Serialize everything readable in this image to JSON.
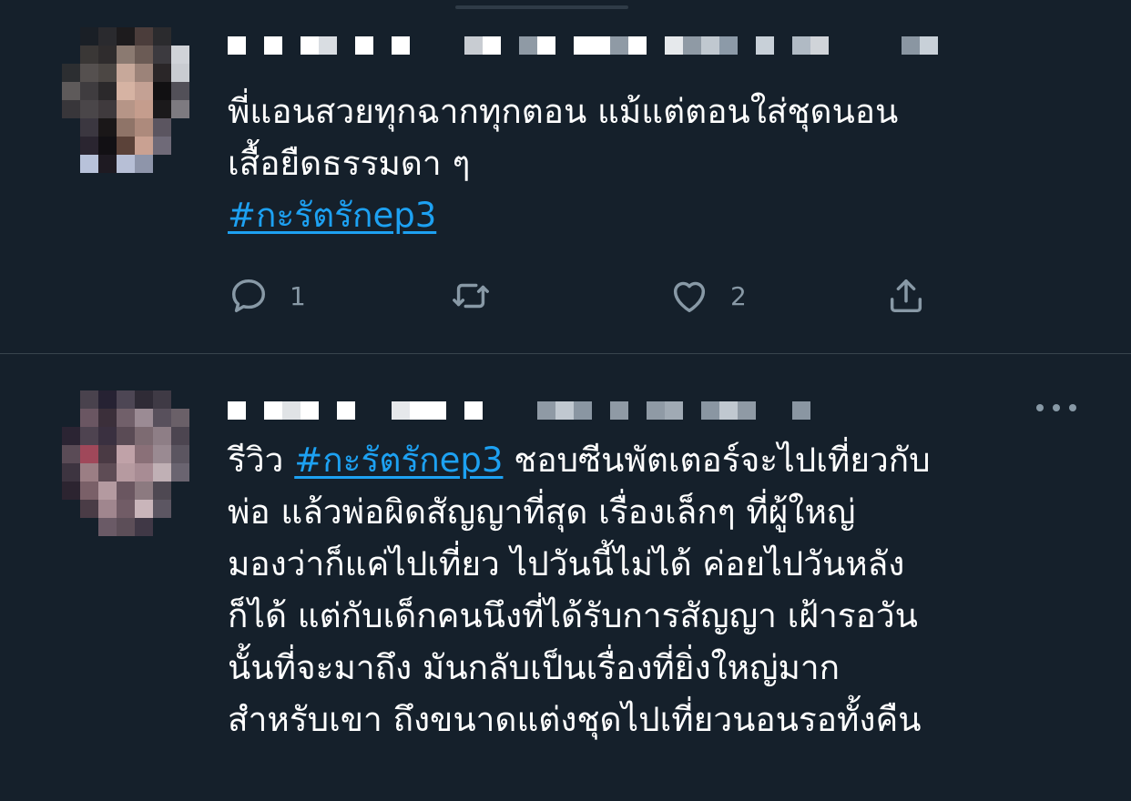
{
  "colors": {
    "background": "#15202b",
    "divider": "#38444d",
    "text": "#ffffff",
    "muted": "#8899a6",
    "link": "#1da1f2"
  },
  "tweets": [
    {
      "text_lines": [
        "พี่แอนสวยทุกฉากทุกตอน แม้แต่ตอนใส่ชุดนอน",
        "เสื้อยืดธรรมดา ๆ"
      ],
      "hashtag": "#กะรัตรักep3",
      "actions": {
        "reply_icon": "reply-icon",
        "reply_count": "1",
        "retweet_icon": "retweet-icon",
        "like_icon": "heart-icon",
        "like_count": "2",
        "share_icon": "share-icon"
      }
    },
    {
      "text_prefix": "รีวิว",
      "hashtag": "#กะรัตรักep3",
      "text_line1_suffix": "ชอบซีนพัตเตอร์จะไปเที่ยวกับ",
      "text_lines": [
        "พ่อ แล้วพ่อผิดสัญญาที่สุด เรื่องเล็กๆ ที่ผู้ใหญ่",
        "มองว่าก็แค่ไปเที่ยว ไปวันนี้ไม่ได้ ค่อยไปวันหลัง",
        "ก็ได้ แต่กับเด็กคนนึงที่ได้รับการสัญญา เฝ้ารอวัน",
        "นั้นที่จะมาถึง มันกลับเป็นเรื่องที่ยิ่งใหญ่มาก",
        "สำหรับเขา ถึงขนาดแต่งชุดไปเที่ยวนอนรอทั้งคืน"
      ],
      "more_icon": "more-options-icon"
    }
  ]
}
